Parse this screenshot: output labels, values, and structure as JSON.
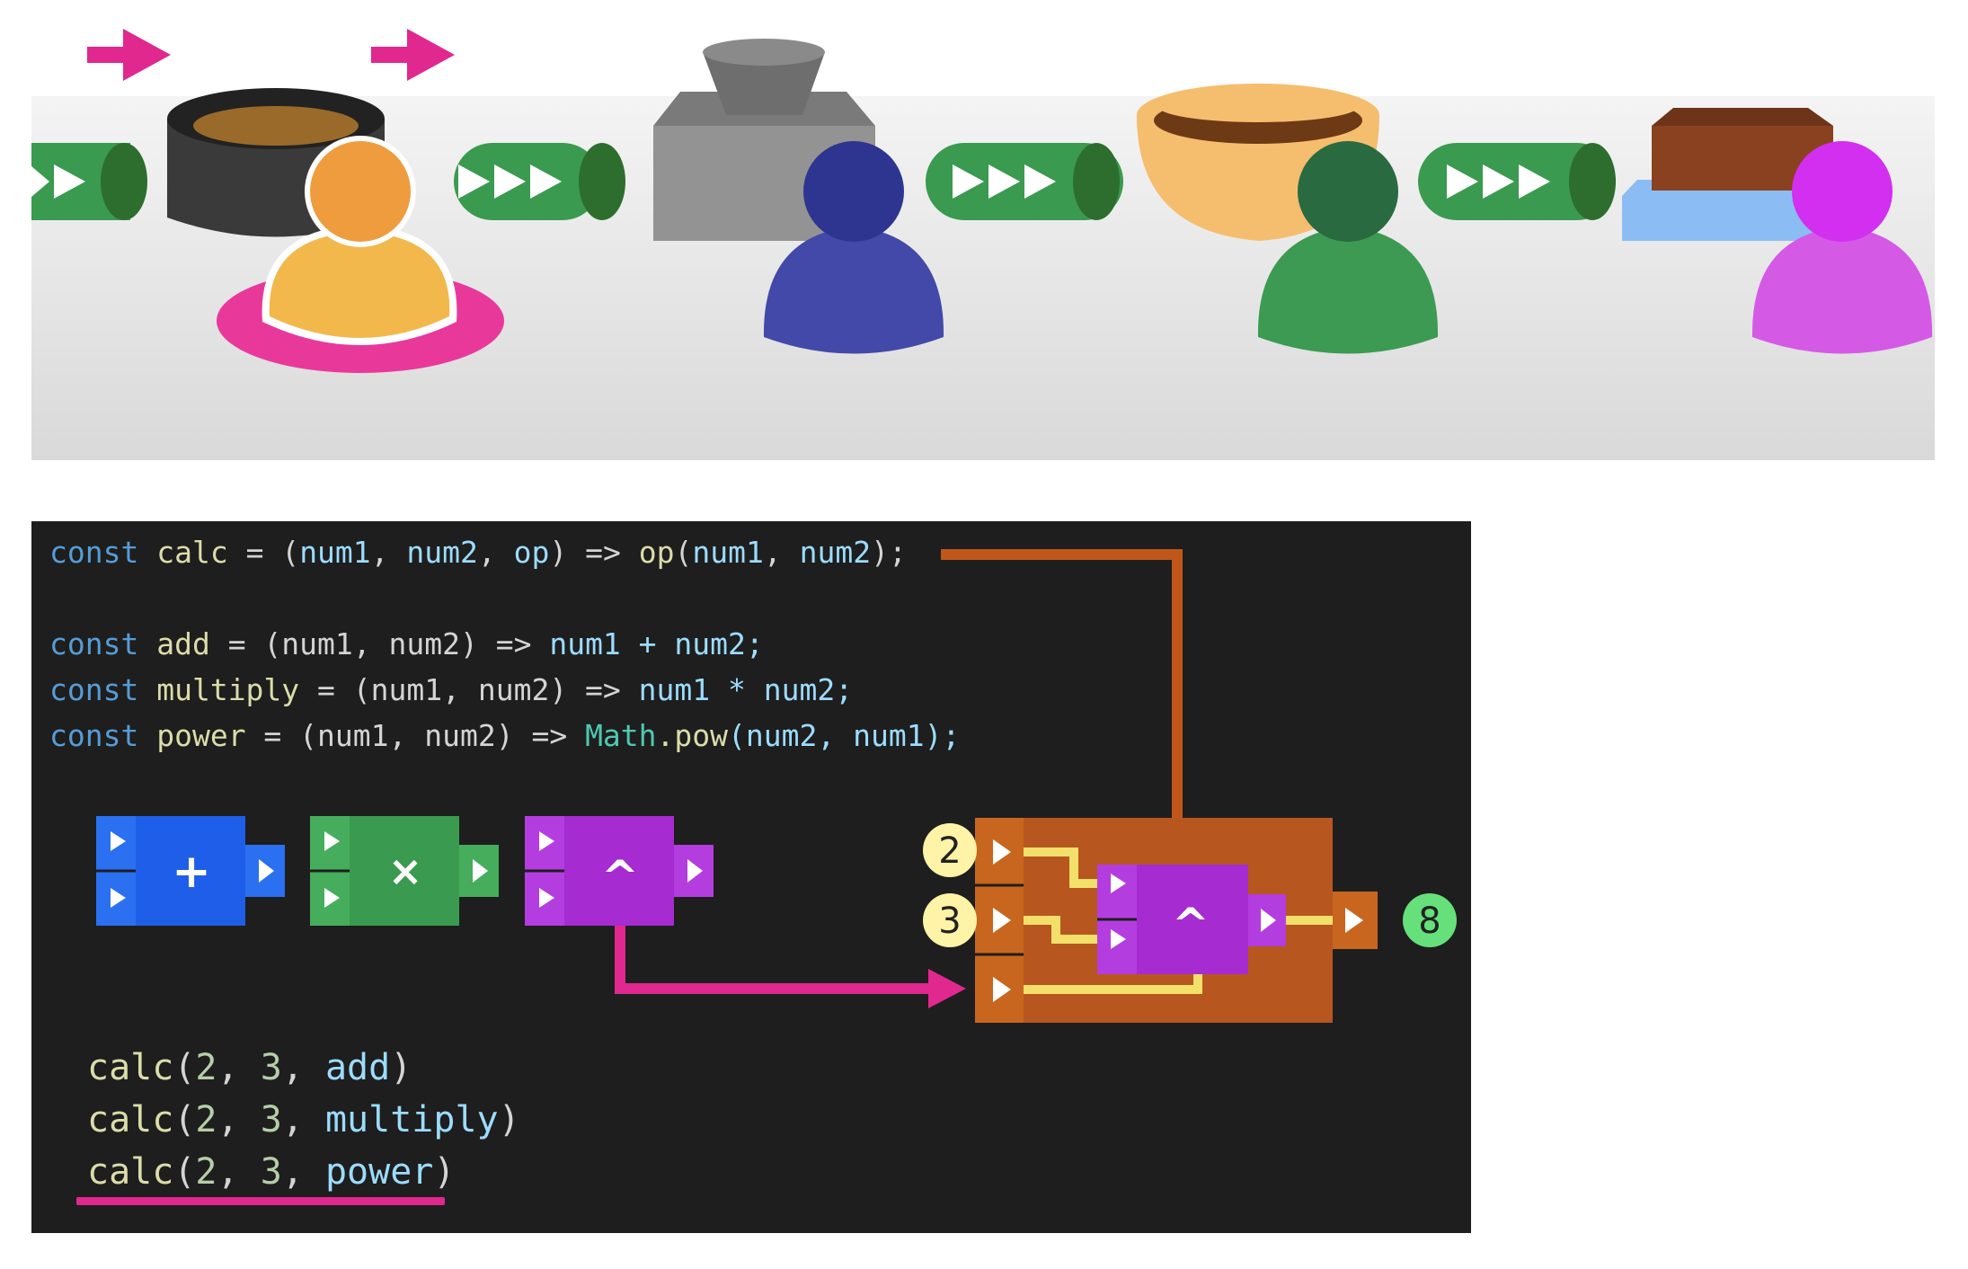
{
  "code": {
    "line1": {
      "kw": "const",
      "name": "calc",
      "eq": " = (",
      "p1": "num1",
      "c1": ", ",
      "p2": "num2",
      "c2": ", ",
      "p3": "op",
      "arrow_open": ") => ",
      "call": "op",
      "args_open": "(",
      "a1": "num1",
      "a2": "num2",
      "end": ");"
    },
    "line2": {
      "kw": "const",
      "name": "add",
      "sig": " = (num1, num2) => ",
      "body": "num1 + num2;"
    },
    "line3": {
      "kw": "const",
      "name": "multiply",
      "sig": " = (num1, num2) => ",
      "body": "num1 * num2;"
    },
    "line4": {
      "kw": "const",
      "name": "power",
      "sig": " = (num1, num2) => ",
      "cls": "Math",
      "method": ".pow",
      "body": "(num2, num1);"
    }
  },
  "calls": [
    {
      "fn": "calc",
      "open": "(",
      "n1": "2",
      "sep1": ", ",
      "n2": "3",
      "sep2": ", ",
      "arg": "add",
      "close": ")"
    },
    {
      "fn": "calc",
      "open": "(",
      "n1": "2",
      "sep1": ", ",
      "n2": "3",
      "sep2": ", ",
      "arg": "multiply",
      "close": ")"
    },
    {
      "fn": "calc",
      "open": "(",
      "n1": "2",
      "sep1": ", ",
      "n2": "3",
      "sep2": ", ",
      "arg": "power",
      "close": ")"
    }
  ],
  "blocks": {
    "add_symbol": "+",
    "multiply_symbol": "×",
    "power_symbol": "^",
    "inner_power_symbol": "^"
  },
  "badges": {
    "input1": "2",
    "input2": "3",
    "output": "8"
  },
  "colors": {
    "add_block": "#1f5ee8",
    "multiply_block": "#3a9a4f",
    "power_block": "#a62bd1",
    "calc_block": "#b8561f",
    "arrow": "#e0288f",
    "wire": "#f2e06b",
    "connector": "#c0561a",
    "code_bg": "#1e1e1e"
  },
  "scene_icons": [
    "arrow-right-icon",
    "arrow-right-icon",
    "pipe-segment-icon",
    "pipe-segment-icon",
    "pipe-segment-icon",
    "pipe-segment-icon",
    "bowl-icon",
    "press-icon",
    "mixing-bowl-icon",
    "tray-icon",
    "person-icon",
    "person-icon",
    "person-icon",
    "person-icon"
  ]
}
